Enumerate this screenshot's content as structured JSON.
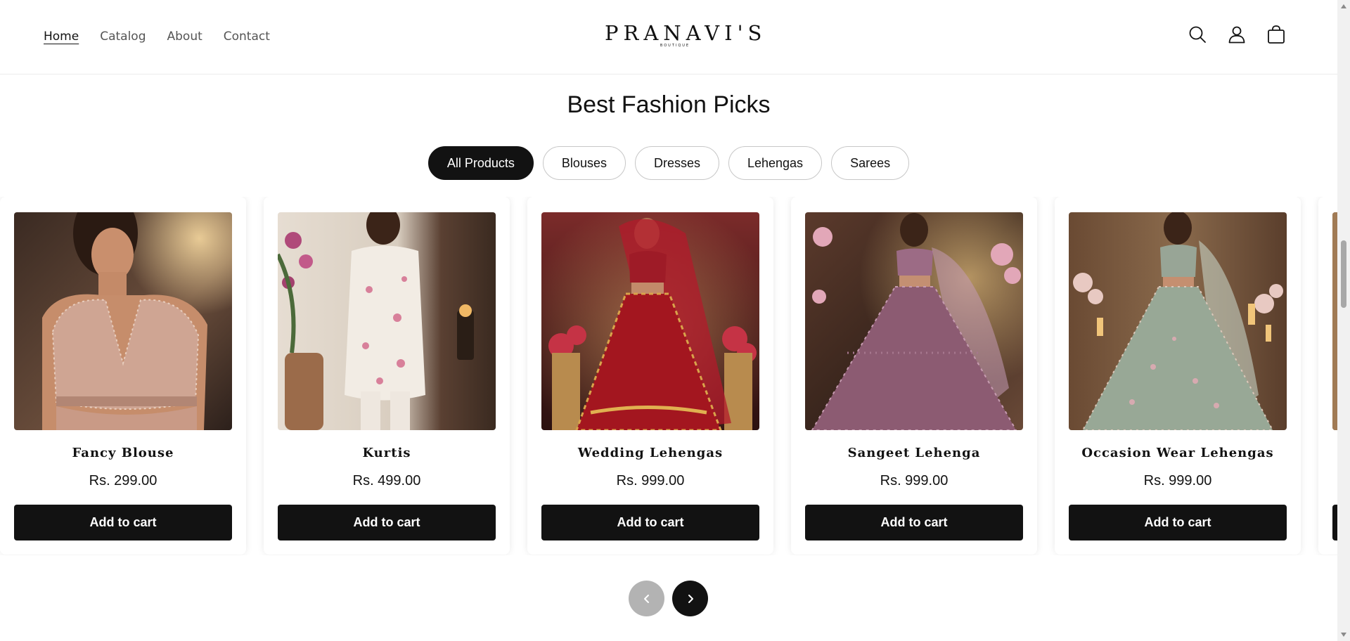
{
  "header": {
    "nav": [
      "Home",
      "Catalog",
      "About",
      "Contact"
    ],
    "logo": {
      "name": "PRANAVI'S",
      "tagline": "BOUTIQUE"
    },
    "icons": [
      "search-icon",
      "account-icon",
      "cart-icon"
    ]
  },
  "section": {
    "title": "Best Fashion Picks",
    "filters": [
      "All Products",
      "Blouses",
      "Dresses",
      "Lehengas",
      "Sarees"
    ],
    "active_filter": "All Products"
  },
  "products": [
    {
      "name": "Fancy Blouse",
      "price": "Rs. 299.00",
      "button": "Add to cart",
      "image": "blouse-photo"
    },
    {
      "name": "Kurtis",
      "price": "Rs. 499.00",
      "button": "Add to cart",
      "image": "kurti-photo"
    },
    {
      "name": "Wedding Lehengas",
      "price": "Rs. 999.00",
      "button": "Add to cart",
      "image": "red-lehenga-photo"
    },
    {
      "name": "Sangeet Lehenga",
      "price": "Rs. 999.00",
      "button": "Add to cart",
      "image": "mauve-lehenga-photo"
    },
    {
      "name": "Occasion Wear Lehengas",
      "price": "Rs. 999.00",
      "button": "Add to cart",
      "image": "sage-lehenga-photo"
    }
  ],
  "carousel": {
    "prev_icon": "chevron-left-icon",
    "next_icon": "chevron-right-icon"
  },
  "colors": {
    "accent": "#121212",
    "disabled": "#b3b3b3",
    "background": "#ffffff"
  }
}
